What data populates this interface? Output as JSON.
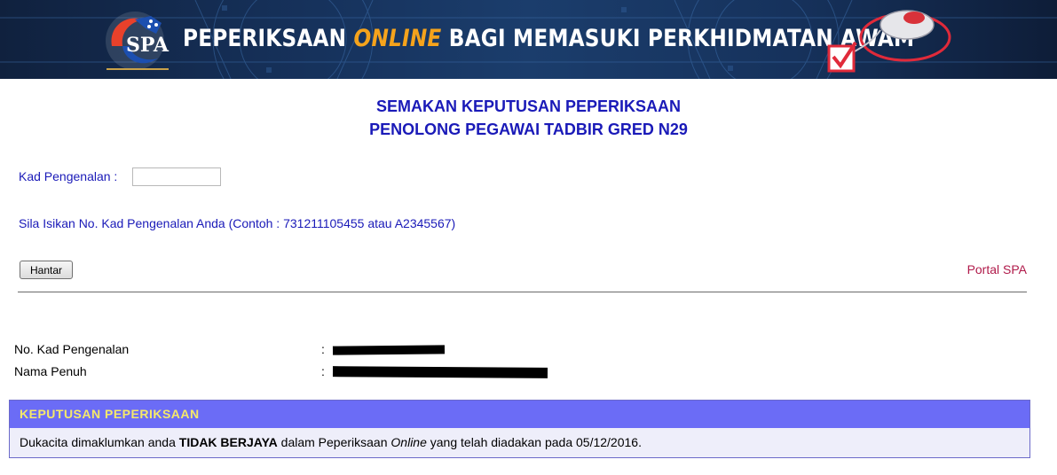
{
  "banner": {
    "title_part1": "PEPERIKSAAN",
    "title_online": "ONLINE",
    "title_part2": "BAGI MEMASUKI PERKHIDMATAN AWAM",
    "logo_icon": "spa-logo-icon",
    "mouse_icon": "mouse-checkbox-icon"
  },
  "heading": {
    "line1": "SEMAKAN KEPUTUSAN PEPERIKSAAN",
    "line2": "PENOLONG PEGAWAI TADBIR GRED N29"
  },
  "form": {
    "kp_label": "Kad Pengenalan :",
    "kp_value": "",
    "hint": "Sila Isikan No. Kad Pengenalan Anda (Contoh : 731211105455 atau A2345567)",
    "submit_label": "Hantar",
    "portal_link": "Portal SPA"
  },
  "info": {
    "no_kp_label": "No. Kad Pengenalan",
    "nama_label": "Nama Penuh",
    "colon": ":"
  },
  "result": {
    "header": "KEPUTUSAN PEPERIKSAAN",
    "text_before": "Dukacita dimaklumkan anda ",
    "text_bold": "TIDAK BERJAYA",
    "text_middle": " dalam Peperiksaan ",
    "text_italic": "Online",
    "text_after": " yang telah diadakan pada 05/12/2016."
  },
  "colors": {
    "heading_blue": "#1a1ab8",
    "link_red": "#b01a4a",
    "result_header_bg": "#6b6cf6",
    "result_header_text": "#f5e96a",
    "online_orange": "#f5a31c"
  }
}
